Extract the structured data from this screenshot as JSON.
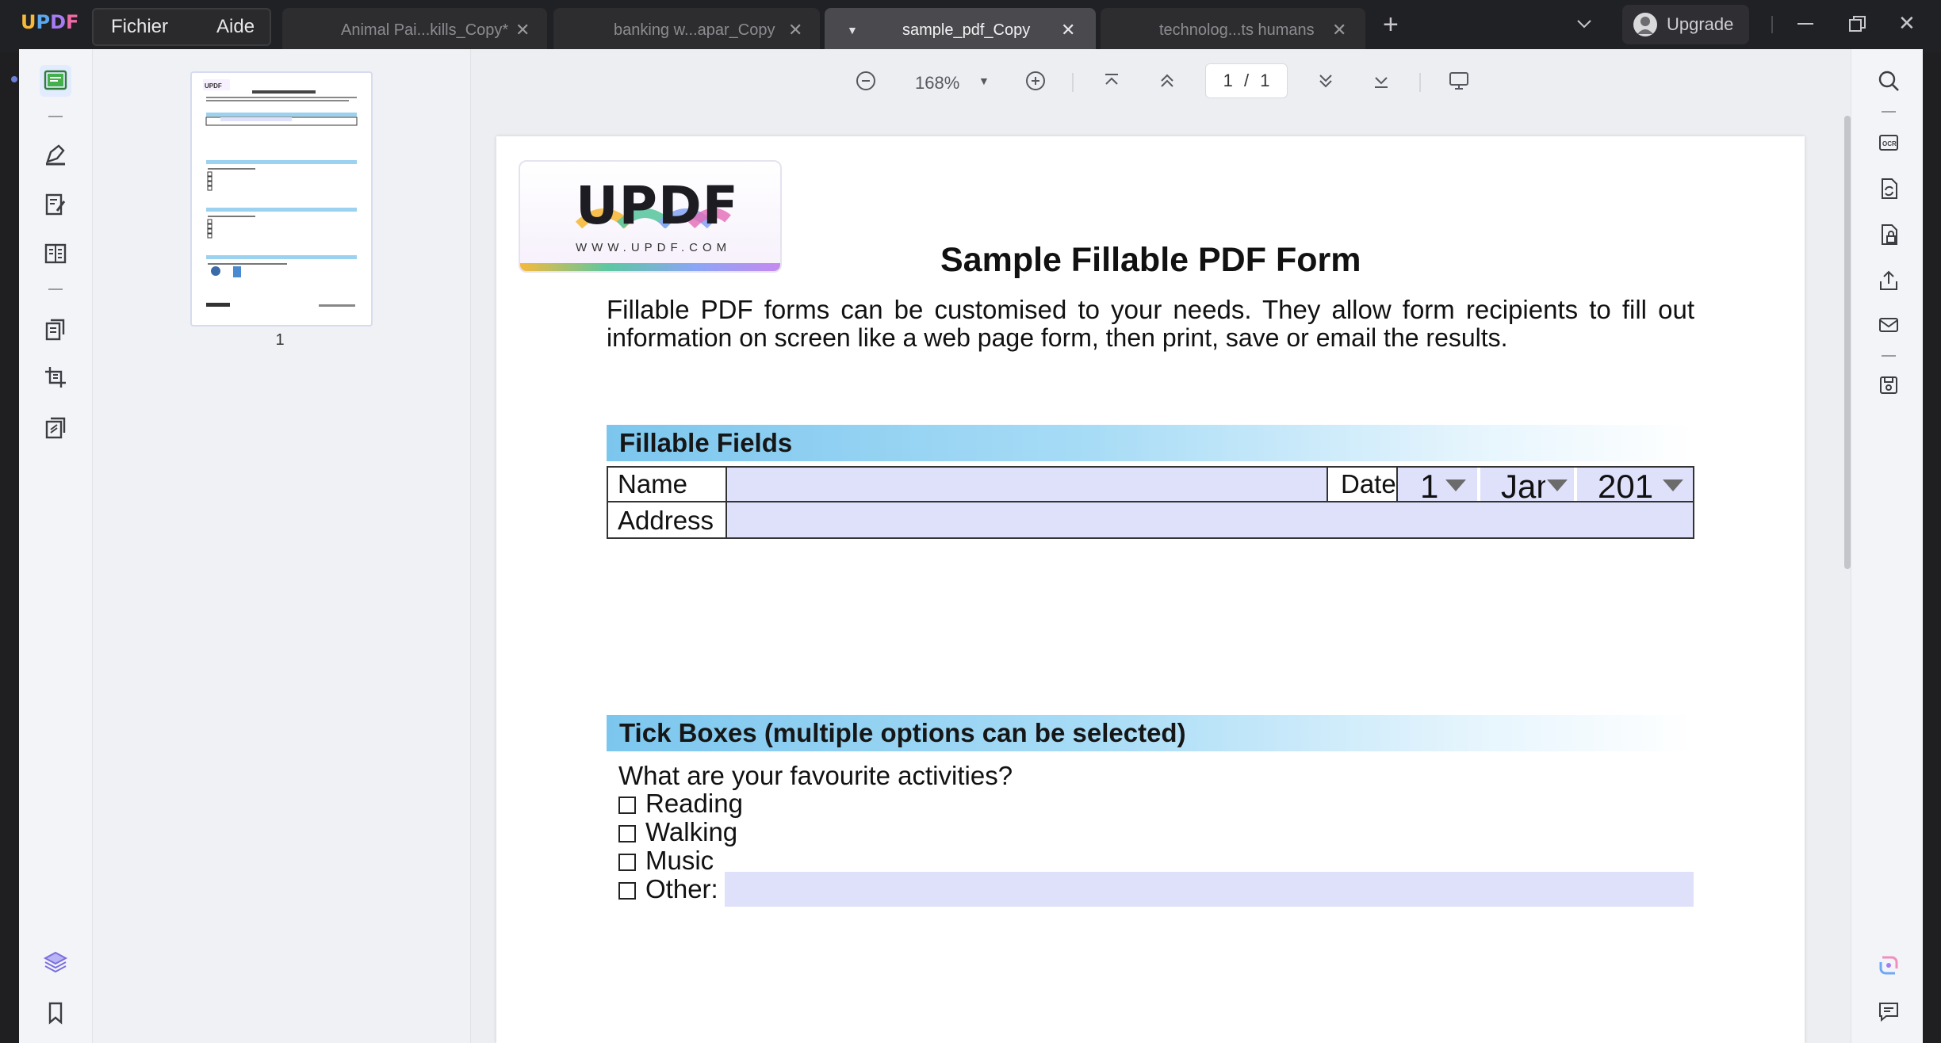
{
  "app": {
    "logo": "UPDF",
    "menu": {
      "file": "Fichier",
      "help": "Aide"
    },
    "upgrade_label": "Upgrade"
  },
  "tabs": [
    {
      "label": "Animal Pai...kills_Copy*",
      "active": false
    },
    {
      "label": "banking w...apar_Copy",
      "active": false
    },
    {
      "label": "sample_pdf_Copy",
      "active": true
    },
    {
      "label": "technolog...ts humans",
      "active": false
    }
  ],
  "toolbar": {
    "zoom": "168%",
    "page_current": "1",
    "page_sep": "/",
    "page_total": "1"
  },
  "thumbnails": [
    {
      "page_label": "1"
    }
  ],
  "document": {
    "logo_text": "UPDF",
    "logo_url": "WWW.UPDF.COM",
    "title": "Sample Fillable PDF Form",
    "intro_line1": "Fillable PDF forms can be customised to your needs. They allow form recipients to fill out",
    "intro_line2": "information on screen like a web page form, then print, save or email the results.",
    "section1": {
      "heading": "Fillable Fields",
      "name_label": "Name",
      "date_label": "Date",
      "address_label": "Address",
      "day_value": "1",
      "month_value": "Jan",
      "year_value": "201"
    },
    "section2": {
      "heading": "Tick Boxes (multiple options can be selected)",
      "question": "What are your favourite activities?",
      "options": [
        "Reading",
        "Walking",
        "Music",
        "Other:"
      ]
    }
  },
  "colors": {
    "accent": "#5b3cf0",
    "band_start": "#7cc6ee",
    "field_fill": "#dfe1fb",
    "titlebar": "#202124"
  }
}
